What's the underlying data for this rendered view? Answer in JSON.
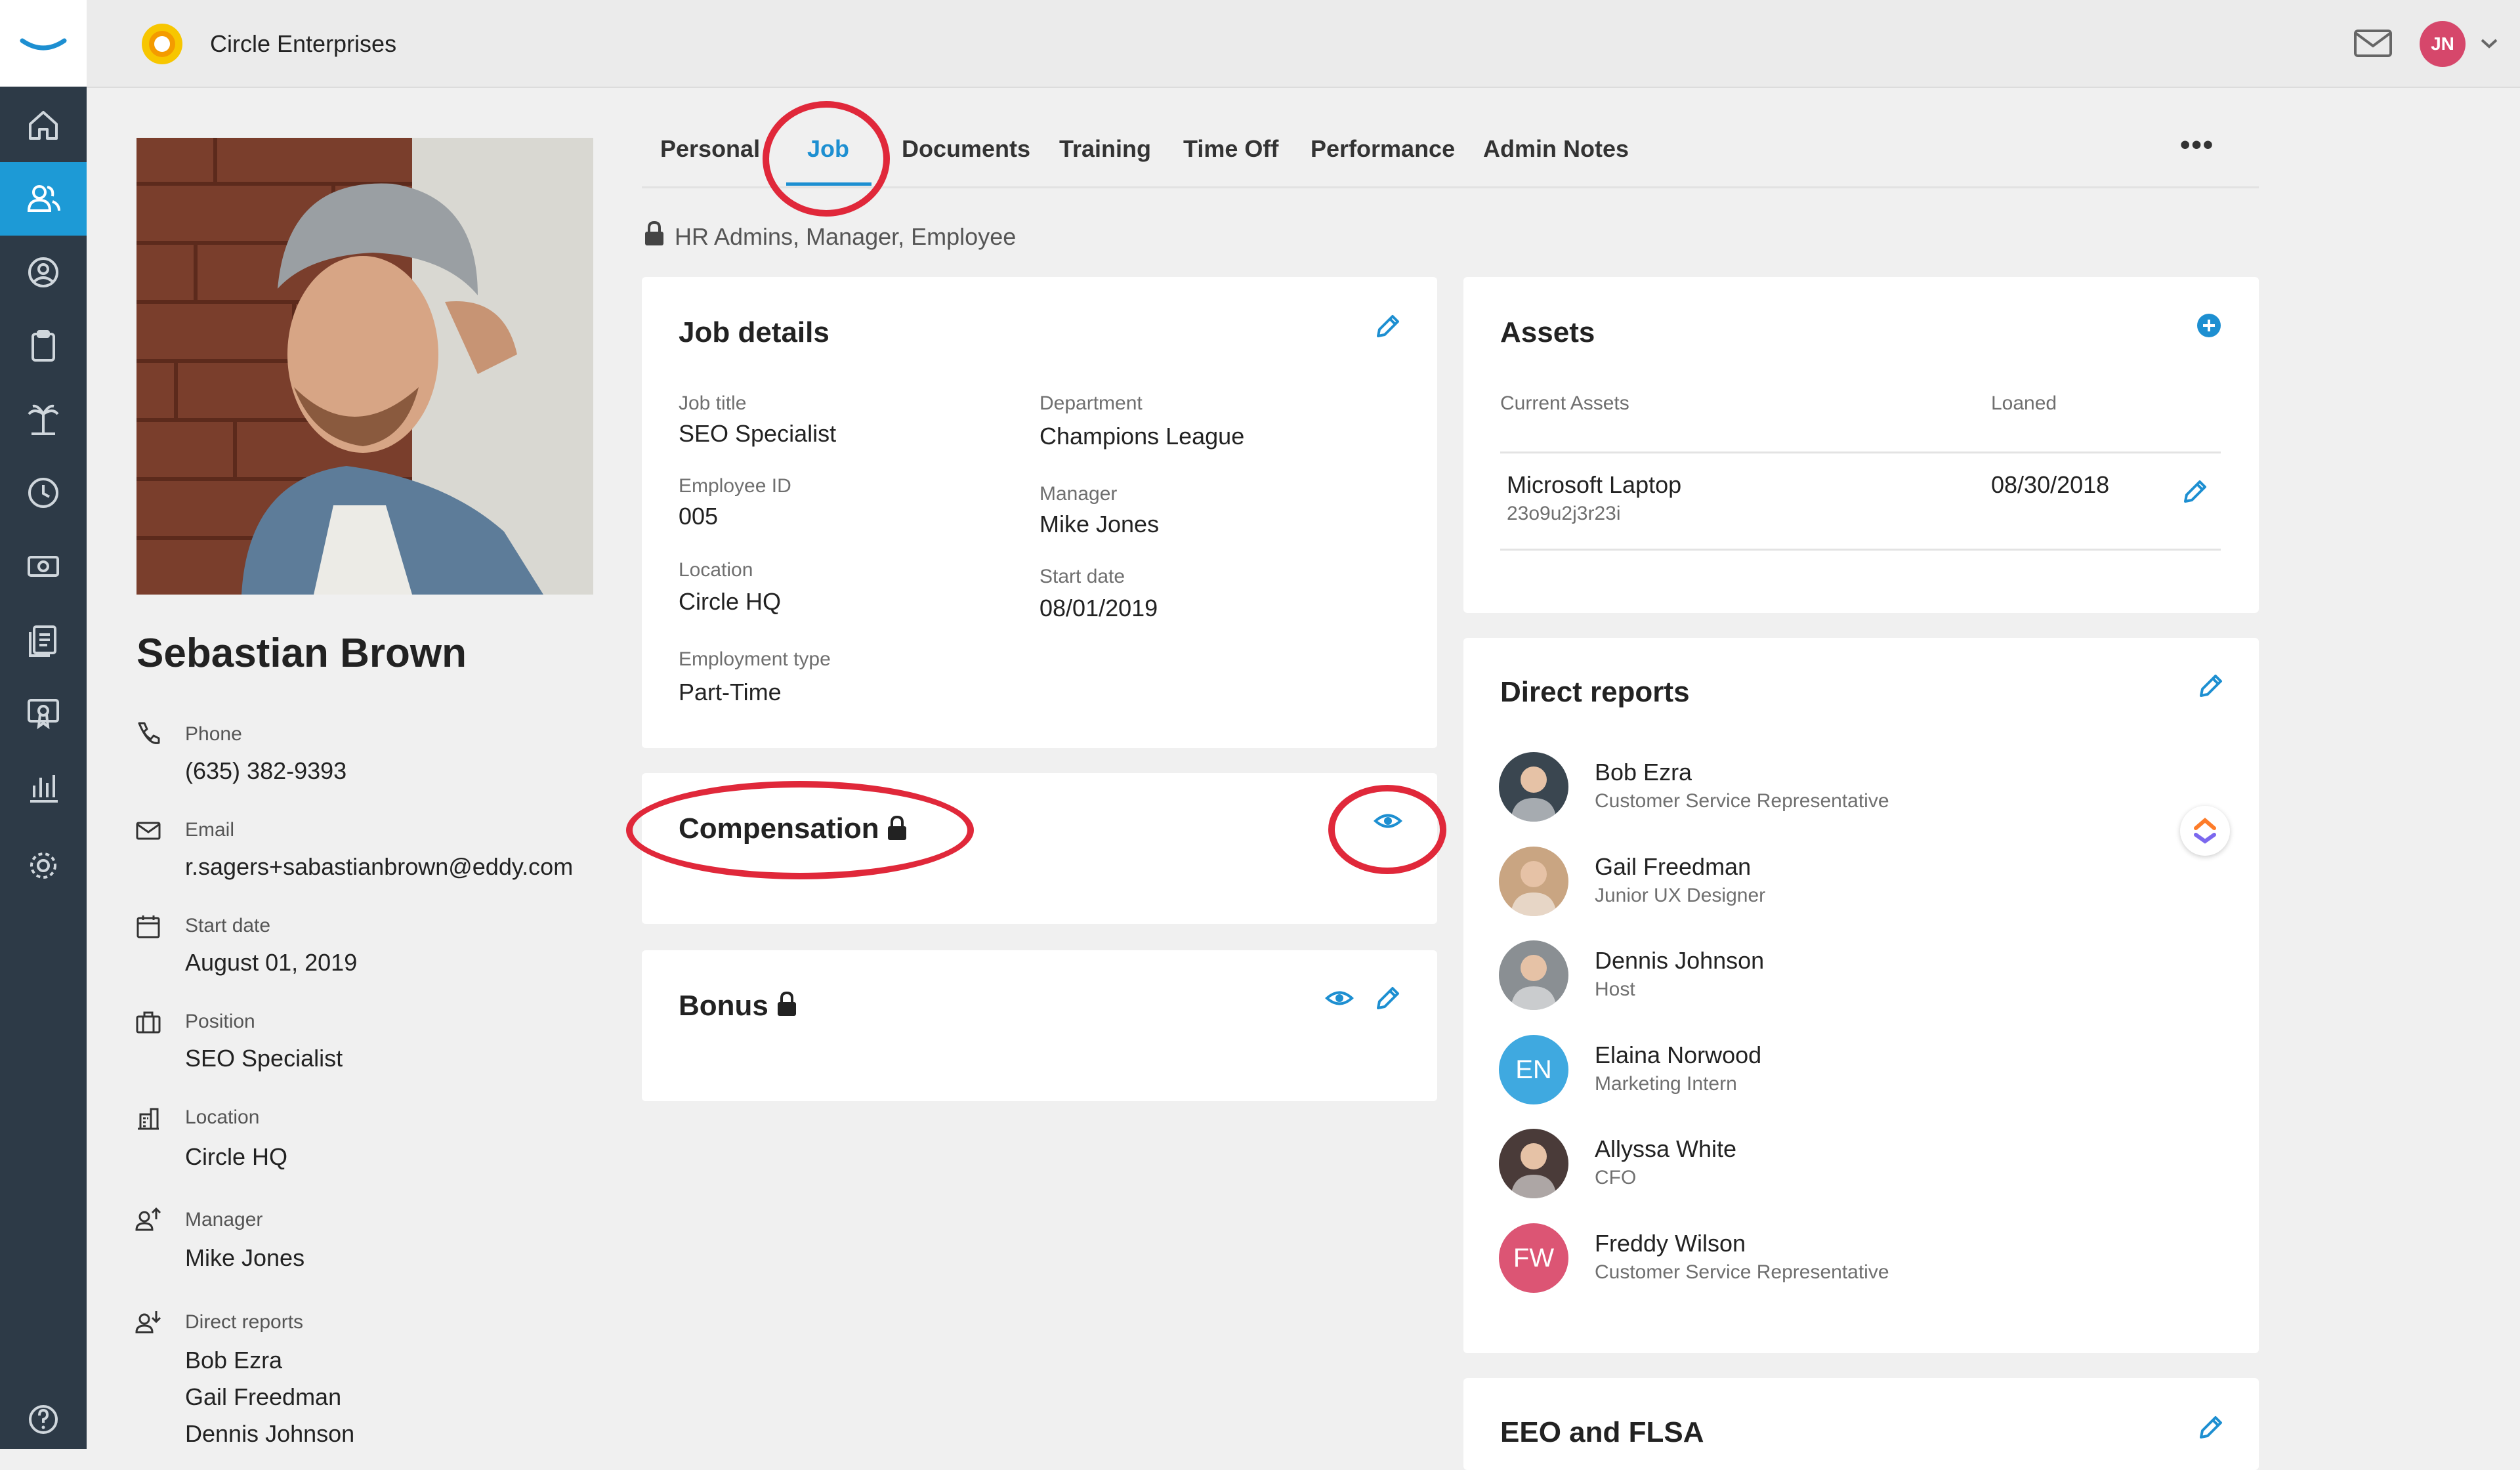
{
  "topbar": {
    "company_name": "Circle Enterprises",
    "user_initials": "JN"
  },
  "profile": {
    "name": "Sebastian Brown",
    "fields": [
      {
        "icon": "phone-icon",
        "label": "Phone",
        "values": [
          "(635) 382-9393"
        ]
      },
      {
        "icon": "email-icon",
        "label": "Email",
        "values": [
          "r.sagers+sabastianbrown@eddy.com"
        ]
      },
      {
        "icon": "calendar-icon",
        "label": "Start date",
        "values": [
          "August 01, 2019"
        ]
      },
      {
        "icon": "briefcase-icon",
        "label": "Position",
        "values": [
          "SEO Specialist"
        ]
      },
      {
        "icon": "building-icon",
        "label": "Location",
        "values": [
          "Circle HQ"
        ]
      },
      {
        "icon": "manager-icon",
        "label": "Manager",
        "values": [
          "Mike Jones"
        ]
      },
      {
        "icon": "direct-reports-icon",
        "label": "Direct reports",
        "values": [
          "Bob Ezra",
          "Gail Freedman",
          "Dennis Johnson"
        ]
      }
    ]
  },
  "tabs": [
    "Personal",
    "Job",
    "Documents",
    "Training",
    "Time Off",
    "Performance",
    "Admin Notes"
  ],
  "active_tab": "Job",
  "more_label": "•••",
  "visibility_note": "HR Admins, Manager, Employee",
  "job_details": {
    "title": "Job details",
    "fields": {
      "job_title": {
        "label": "Job title",
        "value": "SEO Specialist"
      },
      "department": {
        "label": "Department",
        "value": "Champions League"
      },
      "employee_id": {
        "label": "Employee ID",
        "value": "005"
      },
      "manager": {
        "label": "Manager",
        "value": "Mike Jones"
      },
      "location": {
        "label": "Location",
        "value": "Circle HQ"
      },
      "start_date": {
        "label": "Start date",
        "value": "08/01/2019"
      },
      "employment_type": {
        "label": "Employment type",
        "value": "Part-Time"
      }
    }
  },
  "compensation": {
    "title": "Compensation"
  },
  "bonus": {
    "title": "Bonus"
  },
  "assets": {
    "title": "Assets",
    "columns": [
      "Current Assets",
      "Loaned"
    ],
    "rows": [
      {
        "name": "Microsoft Laptop",
        "serial": "23o9u2j3r23i",
        "loaned": "08/30/2018"
      }
    ]
  },
  "direct_reports": {
    "title": "Direct reports",
    "people": [
      {
        "name": "Bob Ezra",
        "title": "Customer Service Representative",
        "initials": "",
        "color": "#3a4650"
      },
      {
        "name": "Gail Freedman",
        "title": "Junior UX Designer",
        "initials": "",
        "color": "#c9a582"
      },
      {
        "name": "Dennis Johnson",
        "title": "Host",
        "initials": "",
        "color": "#8a8f93"
      },
      {
        "name": "Elaina Norwood",
        "title": "Marketing Intern",
        "initials": "EN",
        "color": "#3fa9e0"
      },
      {
        "name": "Allyssa White",
        "title": "CFO",
        "initials": "",
        "color": "#4a3b39"
      },
      {
        "name": "Freddy Wilson",
        "title": "Customer Service Representative",
        "initials": "FW",
        "color": "#dc5574"
      }
    ]
  },
  "eeo": {
    "title": "EEO and FLSA"
  },
  "colors": {
    "accent": "#1d8fd1",
    "sidebar": "#2d3a47",
    "highlight_ring": "#e0283a"
  }
}
